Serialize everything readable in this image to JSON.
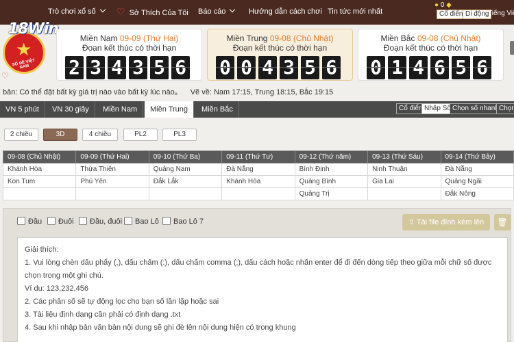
{
  "nav": {
    "items": [
      {
        "label": "Trò chơi xổ số",
        "has_chevron": true
      },
      {
        "label": "Sở Thích Của Tôi",
        "icon": "heart-icon"
      },
      {
        "label": "Báo cáo",
        "has_chevron": true
      },
      {
        "label": "Hướng dẫn cách chơi"
      },
      {
        "label": "Tin tức mới nhất"
      }
    ],
    "account": {
      "count": "0",
      "classic_btn": "Cổ điển",
      "mobile_btn": "Di động",
      "language": "Tiếng Việt"
    }
  },
  "logo": {
    "brand": "18Win",
    "seal_text": "SỐ ĐỀ VIỆT NAM"
  },
  "regions": [
    {
      "name": "Miền Nam",
      "date": "09-09 (Thứ Hai)",
      "subtitle": "Đoạn kết thúc có thời hạn",
      "digits": [
        "2",
        "3",
        "4",
        "3",
        "5",
        "6"
      ],
      "active": false
    },
    {
      "name": "Miền Trung",
      "date": "09-08 (Chủ Nhật)",
      "subtitle": "Đoạn kết thúc có thời hạn",
      "digits": [
        "0",
        "0",
        "4",
        "3",
        "5",
        "6"
      ],
      "active": true
    },
    {
      "name": "Miền Bắc",
      "date": "09-08 (Chủ Nhật)",
      "subtitle": "Đoạn kết thúc có thời hạn",
      "digits": [
        "0",
        "1",
        "4",
        "6",
        "5",
        "6"
      ],
      "active": false
    }
  ],
  "info": {
    "notice": "bản: Có thể đặt bất kỳ giá trị nào vào bất kỳ lúc nào。",
    "draw_times": "Vẽ về: Nam 17:15, Trung 18:15, Bắc 19:15"
  },
  "tabs": {
    "left": [
      "VN 5 phút",
      "VN 30 giây",
      "Miền Nam",
      "Miền Trung",
      "Miền Bắc"
    ],
    "active_left": "Miền Trung",
    "right": [
      "Cổ điển",
      "Nhập Số",
      "Chọn số nhanh",
      "Chọn"
    ],
    "active_right": "Nhập Số"
  },
  "game_types": [
    "2 chiều",
    "3D",
    "4 chiều",
    "PL2",
    "PL3"
  ],
  "active_game_type": "3D",
  "schedule": {
    "headers": [
      "09-08 (Chủ Nhật)",
      "09-09 (Thứ Hai)",
      "09-10 (Thứ Ba)",
      "09-11 (Thứ Tư)",
      "09-12 (Thứ năm)",
      "09-13 (Thứ Sáu)",
      "09-14 (Thứ Bảy)"
    ],
    "rows": [
      [
        "Khánh Hòa",
        "Thừa Thiên",
        "Quảng Nam",
        "Đà Nẵng",
        "Bình Định",
        "Ninh Thuận",
        "Đà Nẵng"
      ],
      [
        "Kon Tum",
        "Phú Yên",
        "Đắk Lắk",
        "Khánh Hòa",
        "Quảng Bình",
        "Gia Lai",
        "Quảng Ngãi"
      ],
      [
        "",
        "",
        "",
        "",
        "Quảng Trị",
        "",
        "Đắk Nông"
      ]
    ]
  },
  "picker": {
    "options": [
      "Đầu",
      "Đuôi",
      "Đầu, đuôi",
      "Bao Lô",
      "Bao Lô 7"
    ],
    "upload_label": "Tải file đính kèm lên"
  },
  "notes": {
    "title": "Giải thích:",
    "lines": [
      "1. Vui lòng chèn dấu phẩy (,), dấu chấm (:), dấu chấm comma (;), dấu cách hoặc nhấn enter để đi đến dòng tiếp theo giữa mỗi chữ số được chọn trong một ghi chú.",
      "Ví dụ: 123,232,456",
      "2. Các phân số sẽ tự động lọc cho bạn số lần lặp hoặc sai",
      "3. Tài liệu định dạng cần phải có định dạng .txt",
      "4. Sau khi nhập bản văn bản nội dung sẽ ghi đè lên nội dung hiện có trong khung"
    ]
  }
}
